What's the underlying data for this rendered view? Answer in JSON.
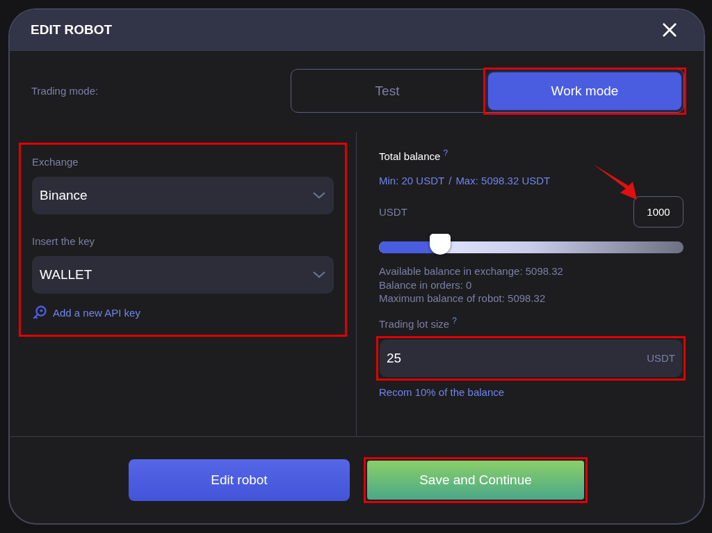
{
  "dialog": {
    "title": "EDIT ROBOT"
  },
  "trading_mode": {
    "label": "Trading mode:",
    "options": [
      {
        "label": "Test",
        "selected": false
      },
      {
        "label": "Work mode",
        "selected": true
      }
    ]
  },
  "exchange": {
    "label": "Exchange",
    "value": "Binance"
  },
  "key": {
    "label": "Insert the key",
    "value": "WALLET"
  },
  "add_key_link": "Add a new API key",
  "total_balance": {
    "label": "Total balance",
    "help": "?",
    "min": "Min: 20 USDT",
    "separator": "/",
    "max": "Max: 5098.32 USDT",
    "unit": "USDT",
    "value": "1000",
    "level": 0.2,
    "info": [
      "Available balance in exchange: 5098.32",
      "Balance in orders: 0",
      "Maximum balance of robot: 5098.32"
    ]
  },
  "lot_size": {
    "label": "Trading lot size",
    "help": "?",
    "value": "25",
    "unit": "USDT",
    "hint": "Recom 10% of the balance"
  },
  "buttons": [
    {
      "label": "Edit robot",
      "kind": "primary"
    },
    {
      "label": "Save and Continue",
      "kind": "success"
    }
  ]
}
